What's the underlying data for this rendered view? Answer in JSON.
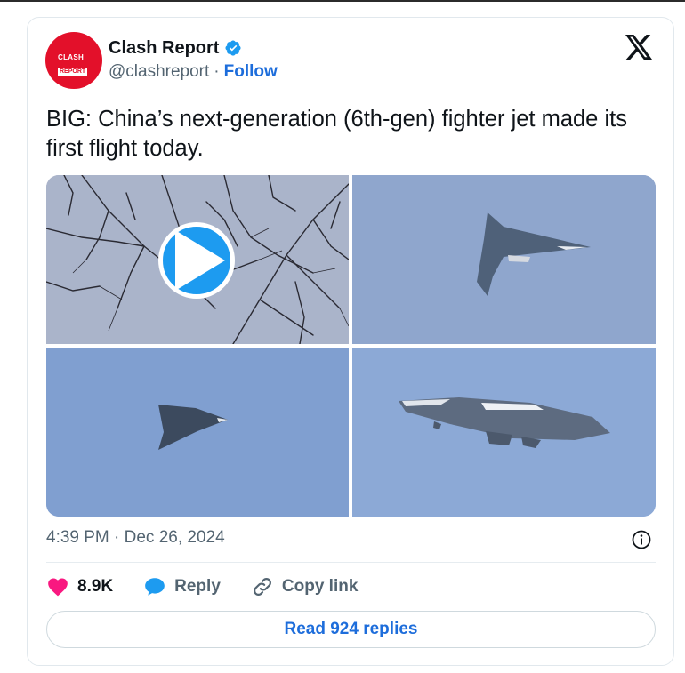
{
  "author": {
    "name": "Clash Report",
    "handle": "@clashreport",
    "separator": "·",
    "follow_label": "Follow",
    "avatar_text_top": "CLASH",
    "avatar_text_bottom": "REPORT",
    "verified": true
  },
  "tweet": {
    "text": "BIG: China’s next-generation (6th-gen) fighter jet made its first flight today.",
    "timestamp": "4:39 PM · Dec 26, 2024"
  },
  "media": {
    "tiles": [
      {
        "content": "video-thumbnail-branches",
        "has_play_button": true
      },
      {
        "content": "jet-top-view"
      },
      {
        "content": "jet-small-distant"
      },
      {
        "content": "jet-side-view"
      }
    ]
  },
  "actions": {
    "likes_count": "8.9K",
    "reply_label": "Reply",
    "copy_link_label": "Copy link"
  },
  "footer": {
    "read_replies_label": "Read 924 replies"
  },
  "colors": {
    "like": "#f91880",
    "reply": "#1d9bf0",
    "link": "#1d6ddb",
    "avatar": "#e3102a"
  },
  "icons": [
    "verified-badge-icon",
    "x-logo-icon",
    "play-icon",
    "info-icon",
    "heart-icon",
    "reply-bubble-icon",
    "link-icon"
  ]
}
